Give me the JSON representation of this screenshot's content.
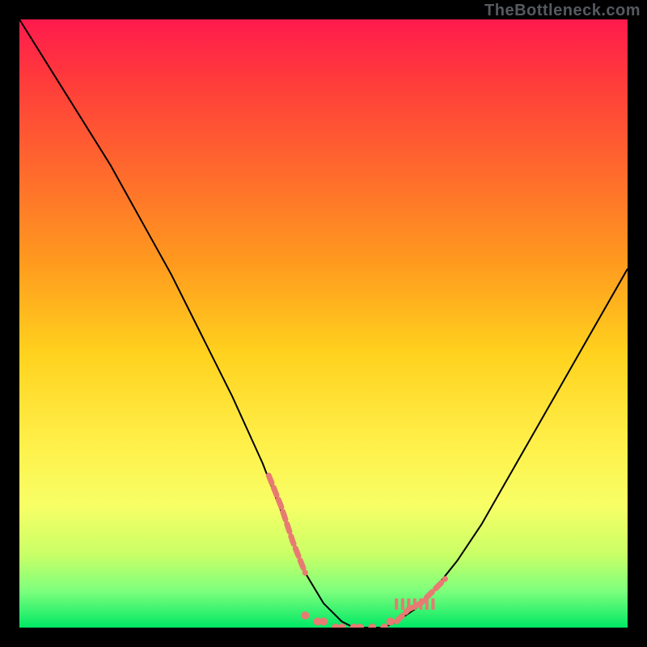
{
  "attribution": "TheBottleneck.com",
  "palette": {
    "frame_bg": "#000000",
    "gradient_top": "#ff1a4d",
    "gradient_bottom": "#00e865",
    "curve": "#000000",
    "markers": "#e77b72"
  },
  "chart_data": {
    "type": "line",
    "title": "",
    "xlabel": "",
    "ylabel": "",
    "legend": false,
    "grid": false,
    "xlim": [
      0,
      100
    ],
    "ylim": [
      0,
      100
    ],
    "x": [
      0,
      5,
      10,
      15,
      20,
      25,
      30,
      35,
      40,
      45,
      47,
      50,
      53,
      55,
      57,
      60,
      62,
      65,
      68,
      72,
      76,
      80,
      84,
      88,
      92,
      96,
      100
    ],
    "values": [
      100,
      92,
      84,
      76,
      67,
      58,
      48,
      38,
      27,
      14,
      9,
      4,
      1,
      0,
      0,
      0,
      1,
      3,
      6,
      11,
      17,
      24,
      31,
      38,
      45,
      52,
      59
    ],
    "highlight": {
      "left_segment_x": [
        41,
        43,
        45,
        47
      ],
      "left_segment_y": [
        25,
        20,
        14,
        9
      ],
      "right_segment_x": [
        62,
        64,
        66,
        68,
        70
      ],
      "right_segment_y": [
        1,
        3,
        4,
        6,
        8
      ],
      "bottom_dots_x": [
        47,
        49,
        50,
        52,
        53,
        55,
        56,
        58,
        60,
        61
      ],
      "bottom_dots_y": [
        2,
        1,
        1,
        0,
        0,
        0,
        0,
        0,
        0,
        1
      ],
      "right_ticks_x": [
        62,
        63,
        64,
        65,
        66,
        67,
        68
      ]
    }
  }
}
